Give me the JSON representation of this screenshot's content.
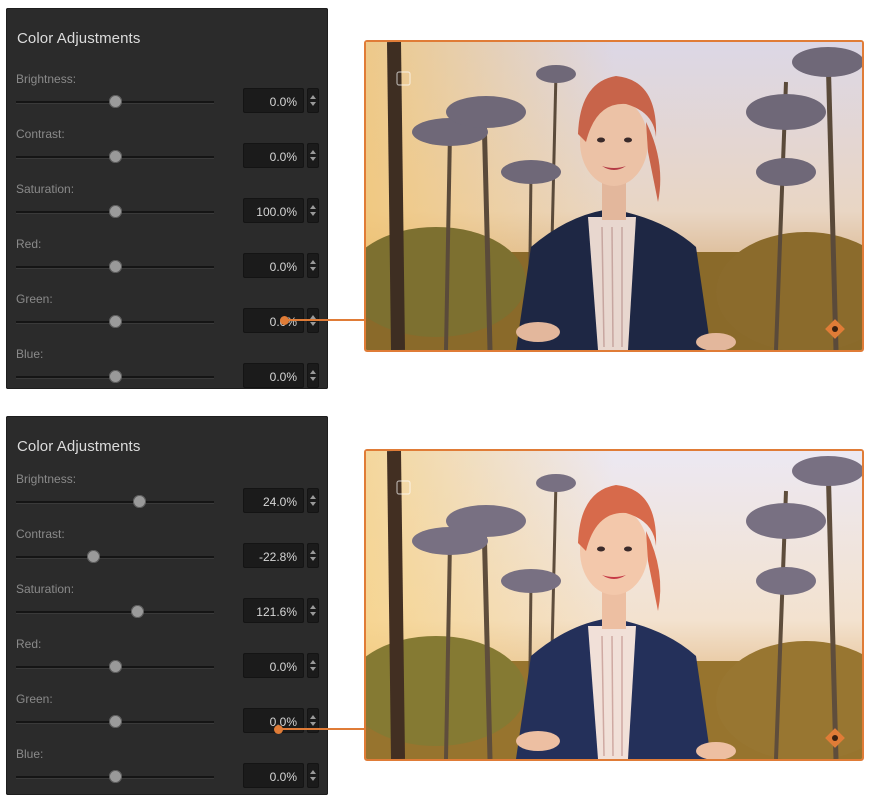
{
  "panels": [
    {
      "title": "Color Adjustments",
      "rows": [
        {
          "label": "Brightness:",
          "value": "0.0%",
          "level": 0.5
        },
        {
          "label": "Contrast:",
          "value": "0.0%",
          "level": 0.5
        },
        {
          "label": "Saturation:",
          "value": "100.0%",
          "level": 0.5
        },
        {
          "label": "Red:",
          "value": "0.0%",
          "level": 0.5
        },
        {
          "label": "Green:",
          "value": "0.0%",
          "level": 0.5
        },
        {
          "label": "Blue:",
          "value": "0.0%",
          "level": 0.5
        }
      ]
    },
    {
      "title": "Color Adjustments",
      "rows": [
        {
          "label": "Brightness:",
          "value": "24.0%",
          "level": 0.62
        },
        {
          "label": "Contrast:",
          "value": "-22.8%",
          "level": 0.39
        },
        {
          "label": "Saturation:",
          "value": "121.6%",
          "level": 0.61
        },
        {
          "label": "Red:",
          "value": "0.0%",
          "level": 0.5
        },
        {
          "label": "Green:",
          "value": "0.0%",
          "level": 0.5
        },
        {
          "label": "Blue:",
          "value": "0.0%",
          "level": 0.5
        }
      ]
    }
  ],
  "colors": {
    "accent": "#e07c37",
    "panel_bg": "#2b2b2b",
    "label": "#8a8a8a",
    "value_text": "#d6d6d6"
  },
  "icons": [
    "stepper-up-icon",
    "stepper-down-icon",
    "checkbox-icon",
    "pin-icon"
  ]
}
